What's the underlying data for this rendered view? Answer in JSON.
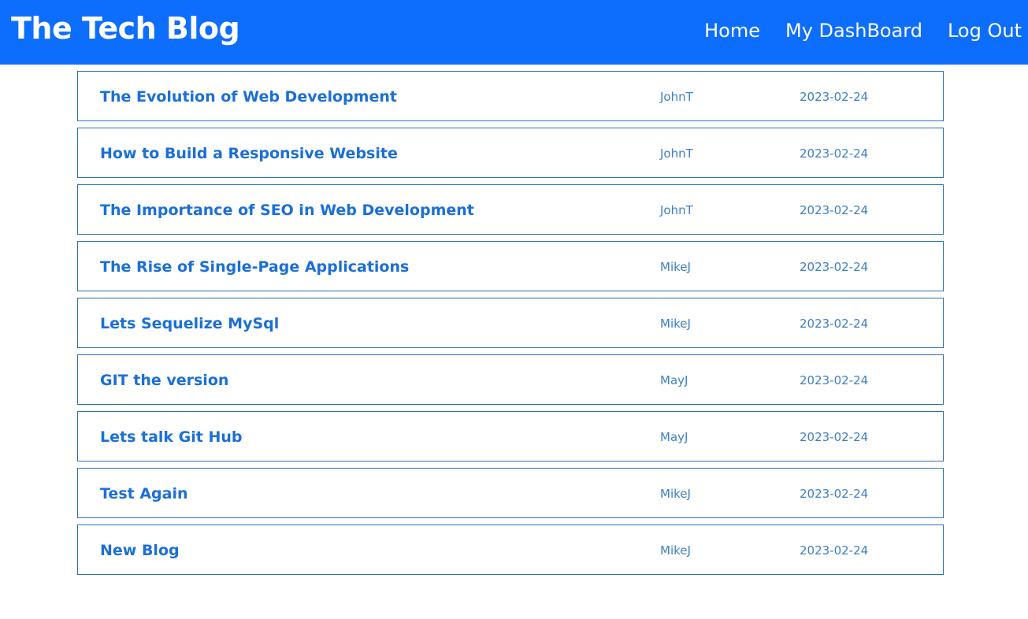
{
  "header": {
    "title": "The Tech Blog",
    "nav": [
      {
        "label": "Home"
      },
      {
        "label": "My DashBoard"
      },
      {
        "label": "Log Out"
      }
    ]
  },
  "posts": [
    {
      "title": "The Evolution of Web Development",
      "author": "JohnT",
      "date": "2023-02-24"
    },
    {
      "title": "How to Build a Responsive Website",
      "author": "JohnT",
      "date": "2023-02-24"
    },
    {
      "title": "The Importance of SEO in Web Development",
      "author": "JohnT",
      "date": "2023-02-24"
    },
    {
      "title": "The Rise of Single-Page Applications",
      "author": "MikeJ",
      "date": "2023-02-24"
    },
    {
      "title": "Lets Sequelize MySql",
      "author": "MikeJ",
      "date": "2023-02-24"
    },
    {
      "title": "GIT the version",
      "author": "MayJ",
      "date": "2023-02-24"
    },
    {
      "title": "Lets talk Git Hub",
      "author": "MayJ",
      "date": "2023-02-24"
    },
    {
      "title": "Test Again",
      "author": "MikeJ",
      "date": "2023-02-24"
    },
    {
      "title": "New Blog",
      "author": "MikeJ",
      "date": "2023-02-24"
    }
  ],
  "colors": {
    "navbar": "#0d6efd",
    "title_link": "#1a6fd8",
    "meta_text": "#3c7fc9",
    "card_border": "#2d6fb8"
  }
}
